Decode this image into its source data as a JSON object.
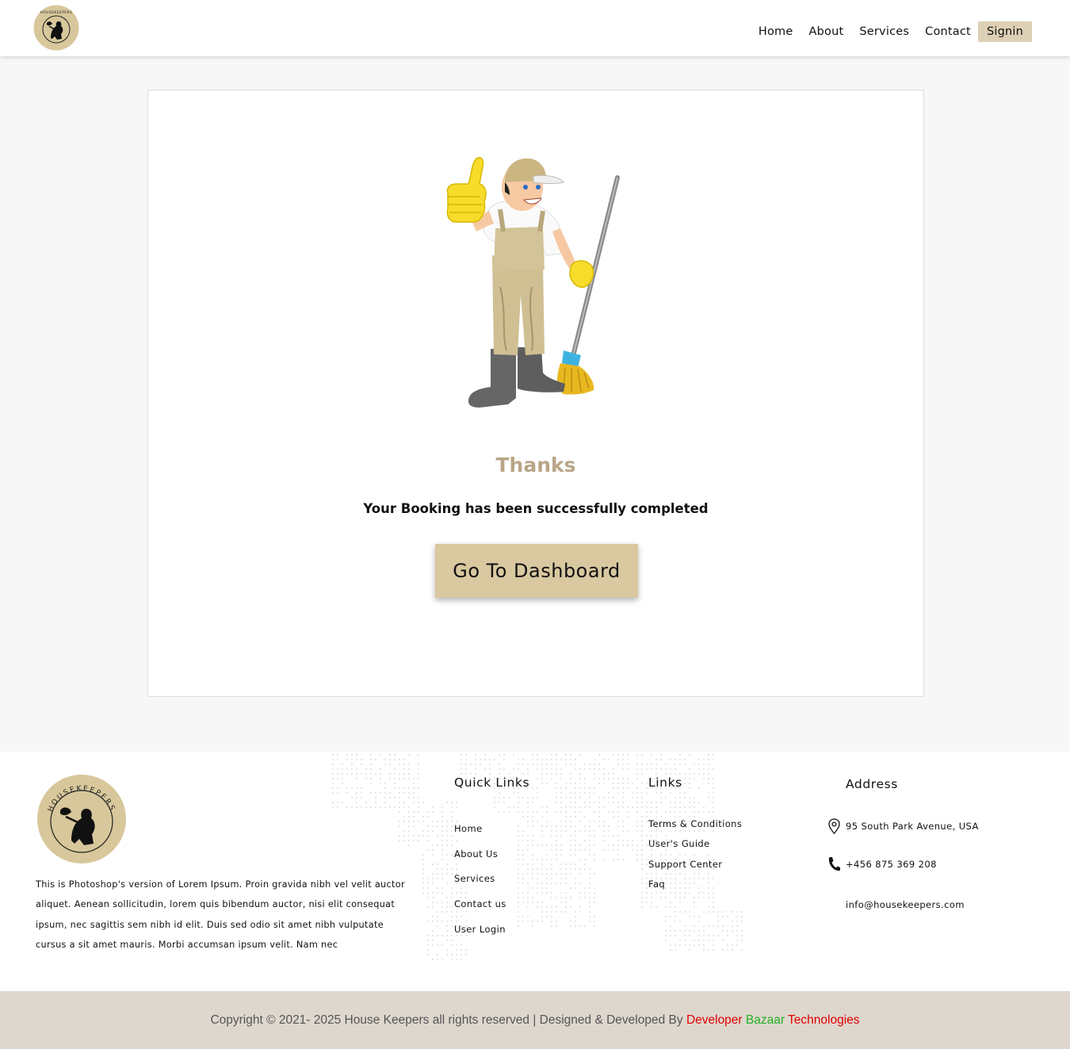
{
  "header": {
    "logo_text": "HOUSEKEEPERS",
    "nav": [
      "Home",
      "About",
      "Services",
      "Contact"
    ],
    "signin_label": "Signin"
  },
  "main": {
    "illustration": "cleaner-thumbs-up-with-mop",
    "title": "Thanks",
    "message": "Your Booking has been successfully completed",
    "button_label": "Go To Dashboard"
  },
  "footer": {
    "logo_text": "HOUSEKEEPERS",
    "about": "This is Photoshop's version  of Lorem Ipsum. Proin gravida nibh vel velit auctor aliquet. Aenean sollicitudin, lorem quis bibendum auctor, nisi elit consequat ipsum, nec sagittis sem nibh id elit. Duis sed odio sit amet nibh vulputate cursus a sit amet mauris. Morbi accumsan ipsum velit. Nam nec",
    "quick_links": {
      "title": "Quick Links",
      "items": [
        "Home",
        "About Us",
        "Services",
        "Contact us",
        "User Login"
      ]
    },
    "links": {
      "title": "Links",
      "items": [
        "Terms & Conditions",
        "User's Guide",
        "Support Center",
        "Faq"
      ]
    },
    "address": {
      "title": "Address",
      "location": "95 South Park Avenue, USA",
      "phone": "+456 875 369 208",
      "email": "info@housekeepers.com"
    }
  },
  "copyright": {
    "text": "Copyright © 2021- 2025 House Keepers all rights reserved | Designed & Developed By ",
    "dev_word1": "Developer",
    "dev_word2": " Bazaar",
    "dev_word3": " Technologies"
  },
  "colors": {
    "accent": "#d9c8a0",
    "title": "#b9a587",
    "footer_bar": "#ded7ce",
    "signin_bg": "#ddd0b5"
  }
}
